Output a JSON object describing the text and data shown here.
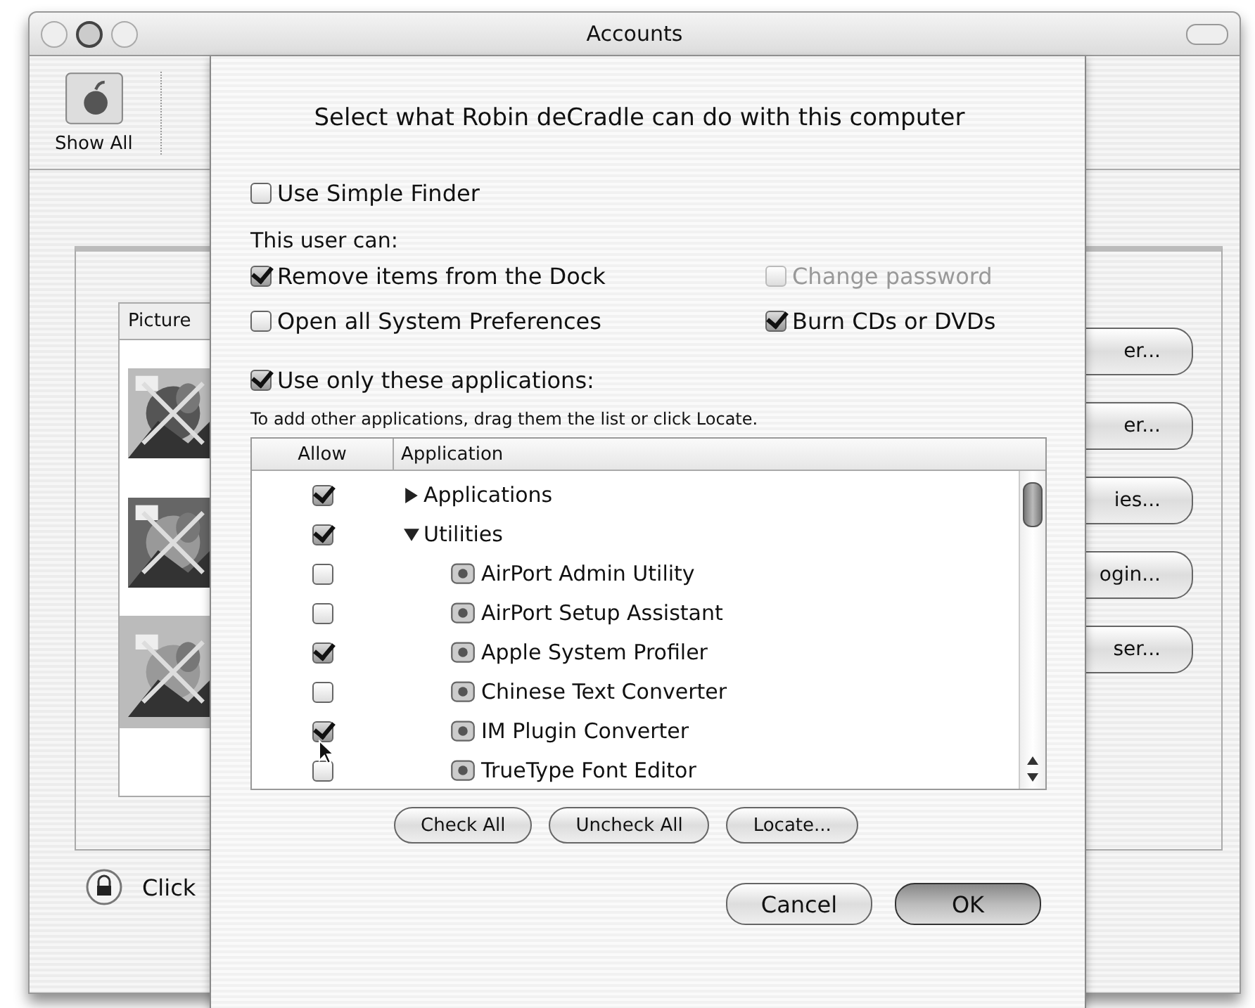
{
  "window": {
    "title": "Accounts",
    "show_all": "Show All",
    "picture_header": "Picture",
    "pictures": [
      {
        "selected": false
      },
      {
        "selected": false
      },
      {
        "selected": true
      }
    ],
    "side_buttons": [
      "er...",
      "er...",
      "ies...",
      "ogin...",
      "ser..."
    ],
    "lock_text": "Click"
  },
  "sheet": {
    "title": "Select what Robin deCradle can do with this computer",
    "simple_finder": {
      "label": "Use Simple Finder",
      "checked": false
    },
    "section_label": "This user can:",
    "permissions": [
      {
        "label": "Remove items from the Dock",
        "checked": true,
        "disabled": false
      },
      {
        "label": "Change password",
        "checked": false,
        "disabled": true
      },
      {
        "label": "Open all System Preferences",
        "checked": false,
        "disabled": false
      },
      {
        "label": "Burn CDs or DVDs",
        "checked": true,
        "disabled": false
      }
    ],
    "only_apps": {
      "label": "Use only these applications:",
      "checked": true
    },
    "hint": "To add other applications, drag them the list or click Locate.",
    "columns": [
      "Allow",
      "Application"
    ],
    "rows": [
      {
        "kind": "folder",
        "name": "Applications",
        "allowed": true,
        "expanded": false
      },
      {
        "kind": "folder",
        "name": "Utilities",
        "allowed": true,
        "expanded": true,
        "children": [
          {
            "name": "AirPort Admin Utility",
            "allowed": false
          },
          {
            "name": "AirPort Setup Assistant",
            "allowed": false
          },
          {
            "name": "Apple System Profiler",
            "allowed": true
          },
          {
            "name": "Chinese Text Converter",
            "allowed": false
          },
          {
            "name": "IM Plugin Converter",
            "allowed": true
          },
          {
            "name": "TrueType Font Editor",
            "allowed": false
          }
        ]
      }
    ],
    "list_buttons": [
      "Check All",
      "Uncheck All",
      "Locate..."
    ],
    "buttons": [
      {
        "label": "Cancel",
        "default": false
      },
      {
        "label": "OK",
        "default": true
      }
    ]
  }
}
